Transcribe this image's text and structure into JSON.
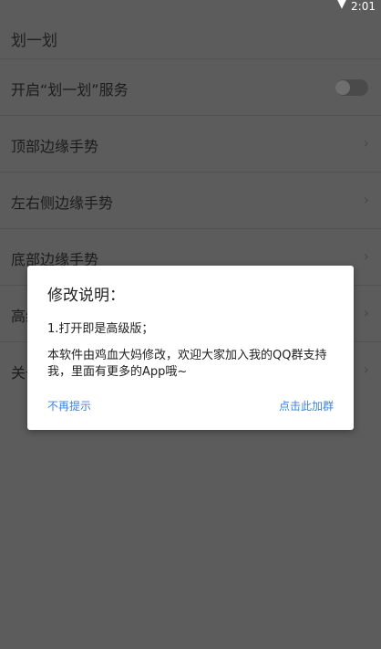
{
  "status_bar": {
    "time": "2:01"
  },
  "app": {
    "title": "划一划"
  },
  "settings": [
    {
      "label": "开启“划一划”服务"
    },
    {
      "label": "顶部边缘手势"
    },
    {
      "label": "左右侧边缘手势"
    },
    {
      "label": "底部边缘手势"
    },
    {
      "label": "高级设置"
    },
    {
      "label": "关于"
    }
  ],
  "service_toggle": {
    "on": false
  },
  "dialog": {
    "title": "修改说明：",
    "line1": "1.打开即是高级版；",
    "line2": "本软件由鸡血大妈修改，欢迎大家加入我的QQ群支持我，里面有更多的App哦~",
    "dismiss_label": "不再提示",
    "join_label": "点击此加群"
  },
  "colors": {
    "accent": "#3f82dd",
    "scrim_background": "#5c5c5c",
    "dialog_background": "#ffffff"
  },
  "icons": {
    "wifi": "wifi-icon",
    "chevron": "chevron-right-icon"
  }
}
